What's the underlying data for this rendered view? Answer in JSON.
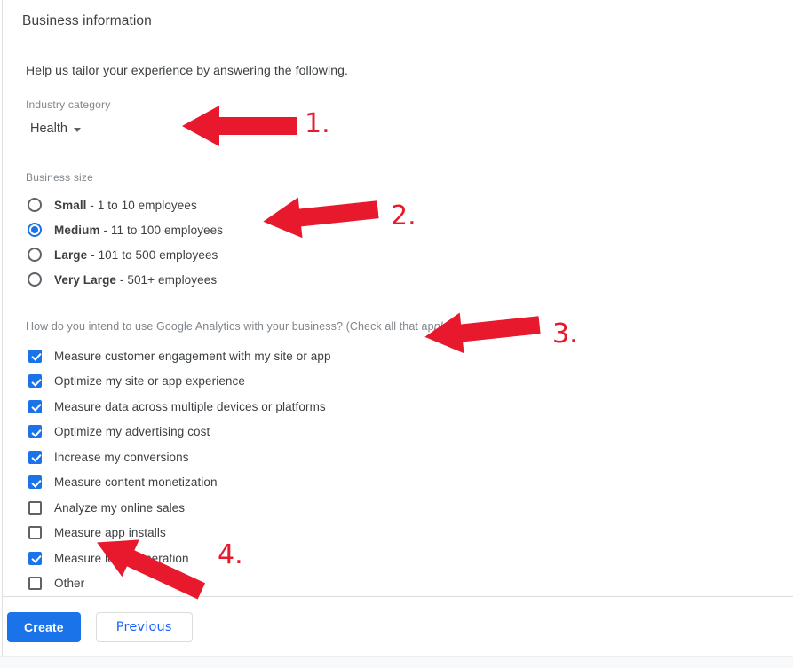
{
  "header": {
    "title": "Business information"
  },
  "main": {
    "intro": "Help us tailor your experience by answering the following.",
    "industry": {
      "label": "Industry category",
      "selected": "Health",
      "caret_icon": "chevron-down-icon"
    },
    "business_size": {
      "label": "Business size",
      "options": [
        {
          "name": "Small",
          "detail": " - 1 to 10 employees",
          "selected": false
        },
        {
          "name": "Medium",
          "detail": " - 11 to 100 employees",
          "selected": true
        },
        {
          "name": "Large",
          "detail": " - 101 to 500 employees",
          "selected": false
        },
        {
          "name": "Very Large",
          "detail": " - 501+ employees",
          "selected": false
        }
      ]
    },
    "intent": {
      "question_main": "How do you intend to use Google Analytics with your business? (Check all that ap",
      "question_italic": "ply)",
      "options": [
        {
          "label": "Measure customer engagement with my site or app",
          "checked": true
        },
        {
          "label": "Optimize my site or app experience",
          "checked": true
        },
        {
          "label": "Measure data across multiple devices or platforms",
          "checked": true
        },
        {
          "label": "Optimize my advertising cost",
          "checked": true
        },
        {
          "label": "Increase my conversions",
          "checked": true
        },
        {
          "label": "Measure content monetization",
          "checked": true
        },
        {
          "label": "Analyze my online sales",
          "checked": false
        },
        {
          "label": "Measure app installs",
          "checked": false
        },
        {
          "label": "Measure lead generation",
          "checked": true
        },
        {
          "label": "Other",
          "checked": false
        }
      ]
    }
  },
  "footer": {
    "create_label": "Create",
    "previous_label": "Previous"
  },
  "annotations": {
    "color": "#e8192c",
    "items": [
      {
        "number": "1.",
        "target": "industry-category-dropdown"
      },
      {
        "number": "2.",
        "target": "business-size-medium-radio"
      },
      {
        "number": "3.",
        "target": "intent-checkbox-list"
      },
      {
        "number": "4.",
        "target": "previous-button"
      }
    ]
  }
}
